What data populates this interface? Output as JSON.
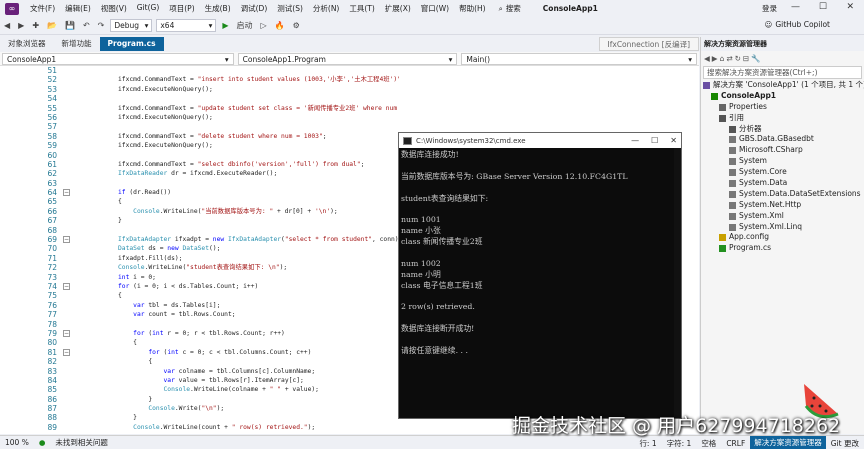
{
  "menu": {
    "items": [
      "文件(F)",
      "编辑(E)",
      "视图(V)",
      "Git(G)",
      "项目(P)",
      "生成(B)",
      "调试(D)",
      "测试(S)",
      "分析(N)",
      "工具(T)",
      "扩展(X)",
      "窗口(W)",
      "帮助(H)"
    ],
    "search": "搜索",
    "app_title": "ConsoleApp1",
    "login": "登录"
  },
  "toolbar": {
    "config": "Debug",
    "platform": "x64",
    "start": "启动",
    "copilot": "GitHub Copilot"
  },
  "tabs": [
    {
      "label": "对象浏览器"
    },
    {
      "label": "新增功能"
    },
    {
      "label": "Program.cs"
    },
    {
      "label": "IfxConnection [反编译]"
    }
  ],
  "nav": {
    "project": "ConsoleApp1",
    "class": "ConsoleApp1.Program",
    "member": "Main()"
  },
  "editor": {
    "line_numbers": [
      "51",
      "52",
      "53",
      "54",
      "55",
      "56",
      "57",
      "58",
      "59",
      "60",
      "61",
      "62",
      "63",
      "64",
      "65",
      "66",
      "67",
      "68",
      "69",
      "70",
      "71",
      "72",
      "73",
      "74",
      "75",
      "76",
      "77",
      "78",
      "79",
      "80",
      "81",
      "82",
      "83",
      "84",
      "85",
      "86",
      "87",
      "88",
      "89"
    ],
    "lines": [
      "",
      "ifxcmd.CommandText = \"insert into student values (1003,'小李','土木工程4班')\";",
      "ifxcmd.ExecuteNonQuery();",
      "",
      "ifxcmd.CommandText = \"update student set class = '新闻传播专业2班' where num = 1001\";",
      "ifxcmd.ExecuteNonQuery();",
      "",
      "ifxcmd.CommandText = \"delete student where num = 1003\";",
      "ifxcmd.ExecuteNonQuery();",
      "",
      "ifxcmd.CommandText = \"select dbinfo('version','full') from dual\";",
      "IfxDataReader dr = ifxcmd.ExecuteReader();",
      "",
      "if (dr.Read())",
      "{",
      "    Console.WriteLine(\"当前数据库版本号为: \" + dr[0] + '\\n');",
      "}",
      "",
      "IfxDataAdapter ifxadpt = new IfxDataAdapter(\"select * from student\", conn);",
      "DataSet ds = new DataSet();",
      "ifxadpt.Fill(ds);",
      "Console.WriteLine(\"student表查询结果如下: \\n\");",
      "int i = 0;",
      "for (i = 0; i < ds.Tables.Count; i++)",
      "{",
      "    var tbl = ds.Tables[i];",
      "    var count = tbl.Rows.Count;",
      "",
      "    for (int r = 0; r < tbl.Rows.Count; r++)",
      "    {",
      "        for (int c = 0; c < tbl.Columns.Count; c++)",
      "        {",
      "            var colname = tbl.Columns[c].ColumnName;",
      "            var value = tbl.Rows[r].ItemArray[c];",
      "            Console.WriteLine(colname + \" \" + value);",
      "        }",
      "        Console.Write(\"\\n\");",
      "    }",
      "    Console.WriteLine(count + \" row(s) retrieved.\");"
    ]
  },
  "console": {
    "title": "C:\\Windows\\system32\\cmd.exe",
    "lines": [
      "数据库连接成功!",
      "",
      "当前数据库版本号为: GBase Server Version 12.10.FC4G1TL",
      "",
      "student表查询结果如下:",
      "",
      "num 1001",
      "name 小张",
      "class 新闻传播专业2班",
      "",
      "num 1002",
      "name 小明",
      "class 电子信息工程1班",
      "",
      "2 row(s) retrieved.",
      "",
      "数据库连接断开成功!",
      "",
      "请按任意键继续. . ."
    ]
  },
  "solution_explorer": {
    "title": "解决方案资源管理器",
    "search_placeholder": "搜索解决方案资源管理器(Ctrl+;)",
    "items": [
      {
        "label": "解决方案 'ConsoleApp1' (1 个项目, 共 1 个)",
        "icon": "solution-icon"
      },
      {
        "label": "ConsoleApp1",
        "icon": "csproj-icon"
      },
      {
        "label": "Properties",
        "icon": "wrench-icon"
      },
      {
        "label": "引用",
        "icon": "references-icon"
      },
      {
        "label": "分析器",
        "icon": "analyzer-icon"
      },
      {
        "label": "GBS.Data.GBasedbt",
        "icon": "assembly-icon"
      },
      {
        "label": "Microsoft.CSharp",
        "icon": "assembly-icon"
      },
      {
        "label": "System",
        "icon": "assembly-icon"
      },
      {
        "label": "System.Core",
        "icon": "assembly-icon"
      },
      {
        "label": "System.Data",
        "icon": "assembly-icon"
      },
      {
        "label": "System.Data.DataSetExtensions",
        "icon": "assembly-icon"
      },
      {
        "label": "System.Net.Http",
        "icon": "assembly-icon"
      },
      {
        "label": "System.Xml",
        "icon": "assembly-icon"
      },
      {
        "label": "System.Xml.Linq",
        "icon": "assembly-icon"
      },
      {
        "label": "App.config",
        "icon": "config-icon"
      },
      {
        "label": "Program.cs",
        "icon": "csharp-file-icon"
      }
    ]
  },
  "status": {
    "zoom": "100 %",
    "issues": "未找到相关问题",
    "row": "行: 1",
    "char": "字符: 1",
    "spaces": "空格",
    "eol": "CRLF",
    "panel": "解决方案资源管理器",
    "git": "Git 更改"
  },
  "watermark": "掘金技术社区 @ 用户627994718262",
  "colors": {
    "accent": "#0e639c",
    "console_bg": "#0c0c0c",
    "keyword": "#0000ff",
    "string": "#a31515",
    "type": "#2b91af"
  }
}
